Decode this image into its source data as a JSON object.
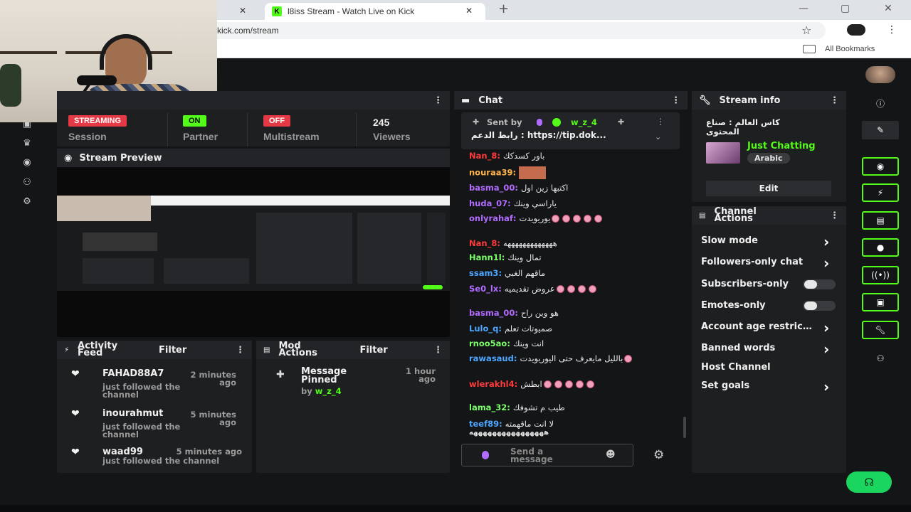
{
  "browser": {
    "tab_title": "l8iss Stream - Watch Live on Kick",
    "url": "kick.com/stream",
    "bookmarks_label": "All Bookmarks",
    "favicon_letter": "K",
    "new_tab": "+",
    "close_glyph": "✕",
    "menu_glyph": "⋮",
    "star_glyph": "☆",
    "folder_glyph": "▭"
  },
  "stats": {
    "session_pill": "STREAMING",
    "session_label": "Session",
    "partner_pill": "ON",
    "partner_label": "Partner",
    "multistream_pill": "OFF",
    "multistream_label": "Multistream",
    "viewers_value": "245",
    "viewers_label": "Viewers"
  },
  "preview": {
    "title": "Stream Preview"
  },
  "chat": {
    "title": "Chat",
    "pinned_sent_by": "Sent by",
    "pinned_user": "w_z_4",
    "pinned_text": "رابط الدعم : https://tip.dok...",
    "messages": [
      {
        "user": "Nan_8",
        "text": "باور كسدكك",
        "color": "#ff3b3b"
      },
      {
        "user": "nouraa39",
        "text": "",
        "color": "#ffb347"
      },
      {
        "user": "basma_00",
        "text": "اكتبها زين اول",
        "color": "#b16cff"
      },
      {
        "user": "huda_07",
        "text": "ياراسي وينك",
        "color": "#b16cff"
      },
      {
        "user": "onlyrahaf",
        "text": "يوريويدت",
        "color": "#b16cff"
      },
      {
        "user": "Nan_8",
        "text": "هههههههههههههه",
        "color": "#ff3b3b"
      },
      {
        "user": "Hann1l",
        "text": "تمال وينك",
        "color": "#7cff6b"
      },
      {
        "user": "ssam3",
        "text": "ماقهم الغبي",
        "color": "#4da6ff"
      },
      {
        "user": "Se0_lx",
        "text": "عروض تقديميه",
        "color": "#b16cff"
      },
      {
        "user": "basma_00",
        "text": "هو وين راح",
        "color": "#b16cff"
      },
      {
        "user": "Lulo_q",
        "text": "صميوتات تعلم",
        "color": "#4da6ff"
      },
      {
        "user": "rnoo5ao",
        "text": "انت وينك",
        "color": "#7cff6b"
      },
      {
        "user": "rawasaud",
        "text": "بالليل مايعرف حتى اليوريويدت",
        "color": "#4da6ff"
      },
      {
        "user": "wlerakhl4",
        "text": "ابطش",
        "color": "#ff3b3b"
      },
      {
        "user": "lama_32",
        "text": "طيب م تشوفك",
        "color": "#7cff6b"
      },
      {
        "user": "teef89",
        "text": "لا انت ماقهمته",
        "color": "#4da6ff"
      }
    ],
    "last_line": "ههههههههههههههههه",
    "input_placeholder": "Send a message"
  },
  "stream_info": {
    "title": "Stream info",
    "stream_title": "كاس العالم : صناع المحتوى",
    "category": "Just Chatting",
    "language": "Arabic",
    "edit_label": "Edit"
  },
  "channel_actions": {
    "title": "Channel Actions",
    "items": [
      {
        "label": "Slow mode",
        "control": "chevron"
      },
      {
        "label": "Followers-only chat",
        "control": "chevron"
      },
      {
        "label": "Subscribers-only",
        "control": "toggle"
      },
      {
        "label": "Emotes-only",
        "control": "toggle"
      },
      {
        "label": "Account age restriction",
        "control": "chevron"
      },
      {
        "label": "Banned words",
        "control": "chevron"
      },
      {
        "label": "Host Channel",
        "control": "none"
      },
      {
        "label": "Set goals",
        "control": "chevron"
      }
    ]
  },
  "activity_feed": {
    "title": "Activity Feed",
    "filter": "Filter",
    "items": [
      {
        "name": "FAHAD88A7",
        "action": "just followed the channel",
        "time": "2 minutes ago"
      },
      {
        "name": "inourahmut",
        "action": "just followed the channel",
        "time": "5 minutes ago"
      },
      {
        "name": "waad99",
        "action": "just followed the channel",
        "time": "5 minutes ago"
      }
    ]
  },
  "mod_actions": {
    "title": "Mod Actions",
    "filter": "Filter",
    "item_title": "Message Pinned",
    "item_by": "by",
    "item_user": "w_z_4",
    "item_time": "1 hour ago"
  },
  "colors": {
    "accent": "#53fc18",
    "streaming": "#e53945",
    "off": "#e53945",
    "panel": "#1e1f21"
  },
  "icons": [
    "info-icon",
    "pencil-icon",
    "screen-icon",
    "bolt-icon",
    "chat-square-icon",
    "chat-bubble-icon",
    "broadcast-icon",
    "layout-icon",
    "wrench-icon",
    "users-icon",
    "trophy-icon",
    "gear-icon",
    "headset-icon"
  ]
}
